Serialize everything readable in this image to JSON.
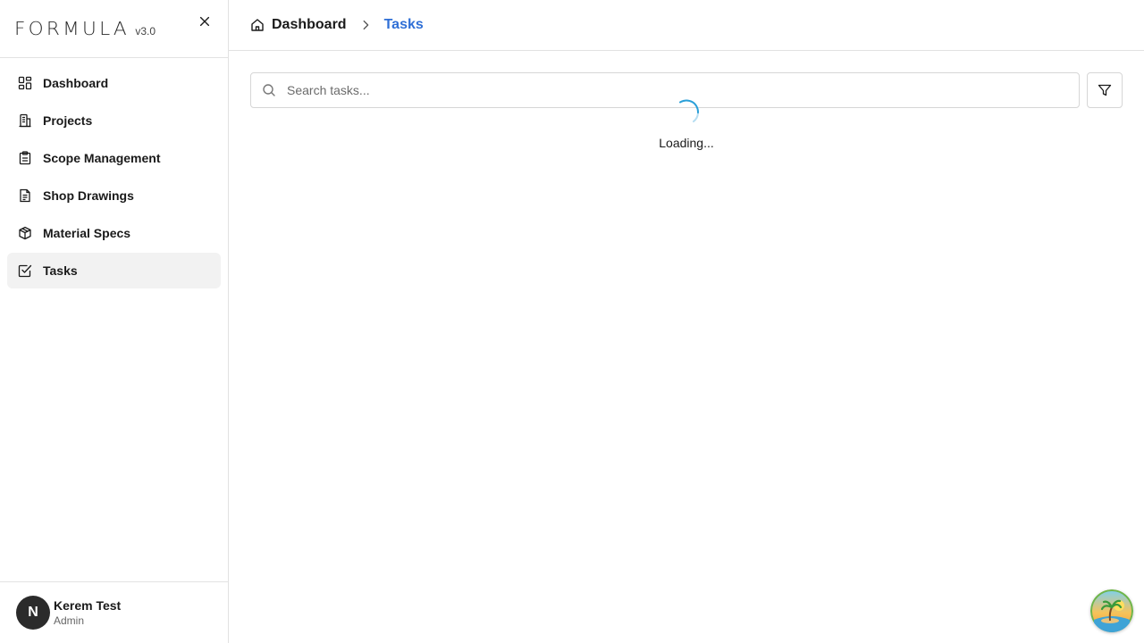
{
  "app": {
    "logo_text": "FORMULA",
    "version": "v3.0"
  },
  "sidebar": {
    "items": [
      {
        "label": "Dashboard",
        "icon": "grid-icon"
      },
      {
        "label": "Projects",
        "icon": "buildings-icon"
      },
      {
        "label": "Scope Management",
        "icon": "clipboard-icon"
      },
      {
        "label": "Shop Drawings",
        "icon": "document-icon"
      },
      {
        "label": "Material Specs",
        "icon": "box-icon"
      },
      {
        "label": "Tasks",
        "icon": "checkbox-icon",
        "active": true
      }
    ]
  },
  "user": {
    "initial": "N",
    "name": "Kerem Test",
    "role": "Admin"
  },
  "breadcrumb": {
    "home": "Dashboard",
    "current": "Tasks"
  },
  "search": {
    "placeholder": "Search tasks...",
    "value": ""
  },
  "status": {
    "loading_text": "Loading..."
  },
  "colors": {
    "accent": "#2f6fd6",
    "spinner": "#2a9fd8",
    "avatar_bg": "#2b2b2b"
  }
}
